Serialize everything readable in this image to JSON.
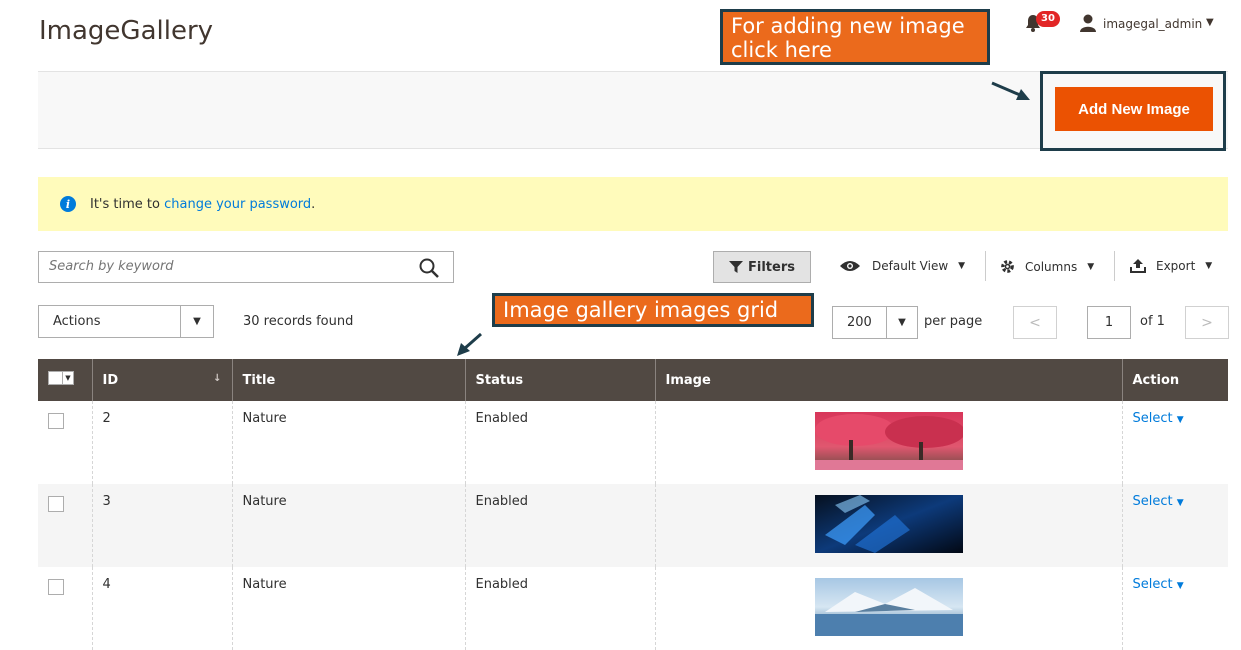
{
  "header": {
    "title": "ImageGallery",
    "notifications_count": "30",
    "user_name": "imagegal_admin"
  },
  "callouts": {
    "add_new": "For adding new image click here",
    "grid": "Image gallery images grid"
  },
  "action_bar": {
    "add_button": "Add New Image"
  },
  "notice": {
    "prefix": "It's time to ",
    "link": "change your password",
    "suffix": "."
  },
  "toolbar": {
    "search_placeholder": "Search by keyword",
    "filters_label": "Filters",
    "view_label": "Default View",
    "columns_label": "Columns",
    "export_label": "Export",
    "actions_label": "Actions",
    "records_found": "30 records found",
    "per_page_value": "200",
    "per_page_label": "per page",
    "page_current": "1",
    "page_total": "of 1"
  },
  "grid": {
    "columns": [
      "ID",
      "Title",
      "Status",
      "Image",
      "Action"
    ],
    "rows": [
      {
        "id": "2",
        "title": "Nature",
        "status": "Enabled",
        "action": "Select",
        "image_kind": "red-trees"
      },
      {
        "id": "3",
        "title": "Nature",
        "status": "Enabled",
        "action": "Select",
        "image_kind": "blue-abstract"
      },
      {
        "id": "4",
        "title": "Nature",
        "status": "Enabled",
        "action": "Select",
        "image_kind": "snow-mountain"
      }
    ]
  },
  "colors": {
    "accent": "#eb5202",
    "callout": "#eb6a1c",
    "header_bg": "#514943",
    "link": "#007bdb",
    "notice_bg": "#fffbbb"
  }
}
